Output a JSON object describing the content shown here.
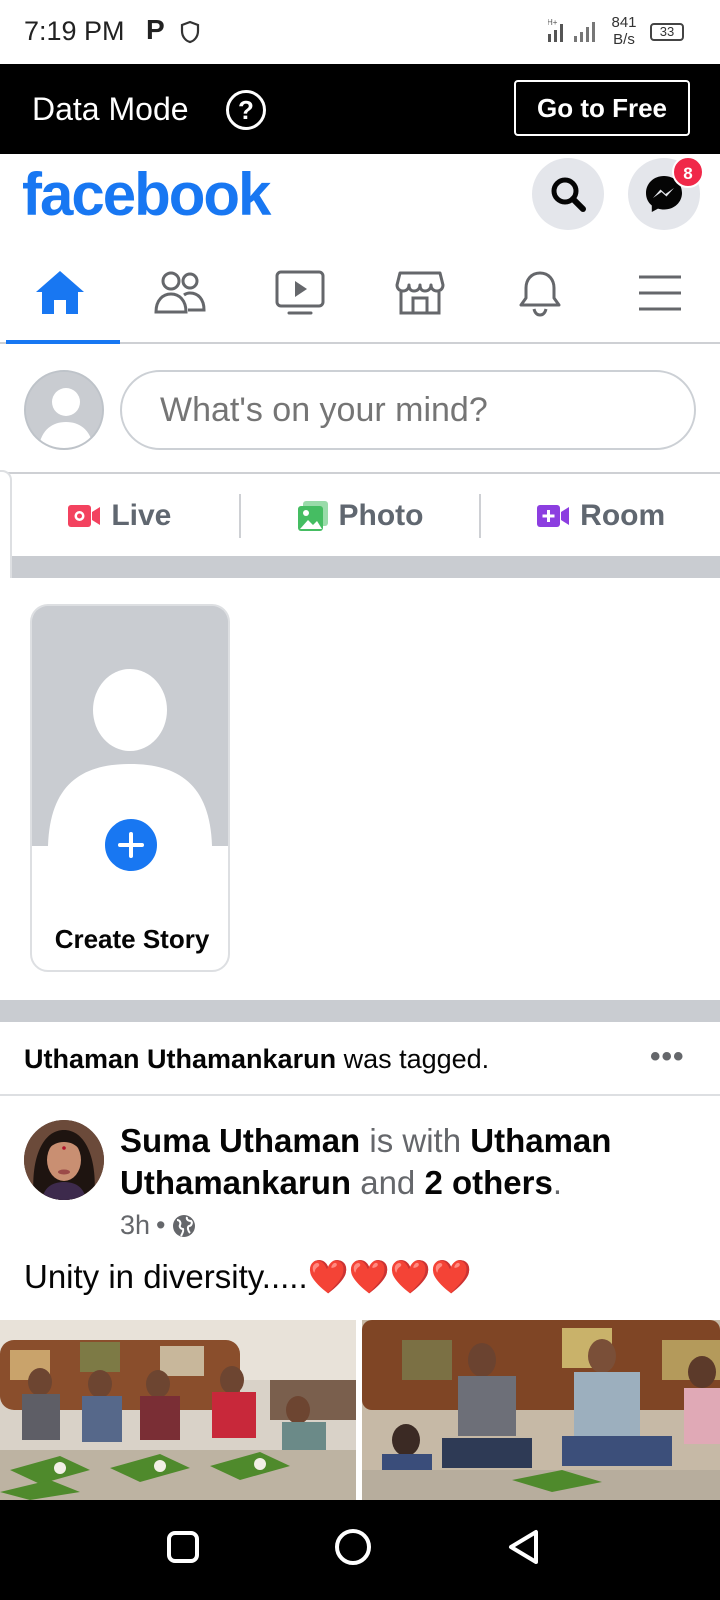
{
  "status_bar": {
    "time": "7:19 PM",
    "p_indicator": "P",
    "net_speed_value": "841",
    "net_speed_unit": "B/s",
    "battery": "33"
  },
  "data_mode": {
    "title": "Data Mode",
    "help_icon_label": "?",
    "button_label": "Go to Free"
  },
  "header": {
    "logo": "facebook",
    "messenger_badge": "8"
  },
  "nav_tabs": [
    {
      "icon": "home-icon",
      "active": true
    },
    {
      "icon": "friends-icon",
      "active": false
    },
    {
      "icon": "watch-icon",
      "active": false
    },
    {
      "icon": "marketplace-icon",
      "active": false
    },
    {
      "icon": "bell-icon",
      "active": false
    },
    {
      "icon": "menu-icon",
      "active": false
    }
  ],
  "composer": {
    "placeholder": "What's on your mind?"
  },
  "actions": {
    "live": "Live",
    "photo": "Photo",
    "room": "Room"
  },
  "story": {
    "label": "Create Story"
  },
  "post": {
    "context_name": "Uthaman Uthamankarun",
    "context_suffix": " was tagged.",
    "more": "•••",
    "author": "Suma Uthaman",
    "with_text": " is with ",
    "tagged_name": "Uthaman Uthamankarun",
    "and_text": " and ",
    "others": "2 others",
    "period": ".",
    "time": "3h",
    "dot": "•",
    "text": "Unity in diversity.....❤️❤️❤️❤️"
  },
  "colors": {
    "brand": "#1877f2",
    "badge": "#f02849",
    "live": "#f3425f",
    "photo": "#45bd62",
    "room": "#8c3ee0"
  }
}
